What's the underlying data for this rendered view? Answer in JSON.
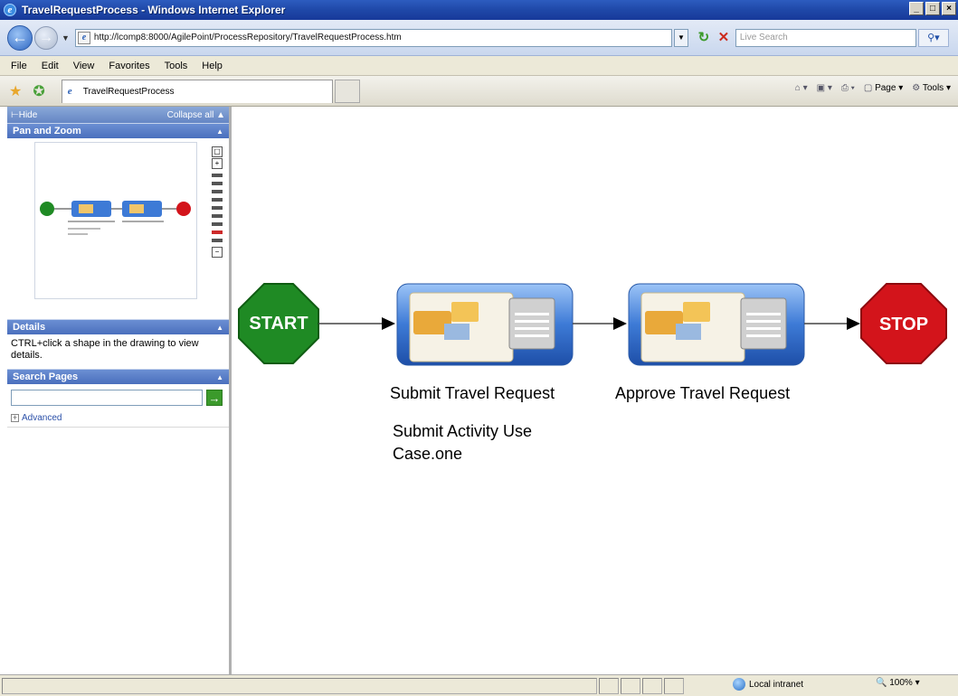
{
  "window": {
    "title": "TravelRequestProcess - Windows Internet Explorer",
    "controls": {
      "minimize": "_",
      "maximize": "□",
      "close": "×"
    }
  },
  "address_bar": {
    "url": "http://lcomp8:8000/AgilePoint/ProcessRepository/TravelRequestProcess.htm",
    "search_placeholder": "Live Search"
  },
  "menu": [
    "File",
    "Edit",
    "View",
    "Favorites",
    "Tools",
    "Help"
  ],
  "tab": {
    "label": "TravelRequestProcess"
  },
  "command_bar": {
    "page": "Page",
    "tools": "Tools"
  },
  "left_panel": {
    "hide_label": "Hide",
    "collapse_all": "Collapse all",
    "pan_zoom": {
      "header": "Pan and Zoom"
    },
    "details": {
      "header": "Details",
      "text": "CTRL+click a shape in the drawing to view details."
    },
    "search_pages": {
      "header": "Search Pages",
      "advanced_label": "Advanced"
    }
  },
  "diagram": {
    "start_label": "START",
    "stop_label": "STOP",
    "steps": [
      {
        "name": "Submit Travel Request",
        "note_line1": "Submit Activity Use",
        "note_line2": "Case.one"
      },
      {
        "name": "Approve Travel Request"
      }
    ],
    "colors": {
      "start": "#1f8a24",
      "stop": "#d3141b",
      "task": "#2e6fd0"
    }
  },
  "status_bar": {
    "zone": "Local intranet",
    "zoom": "100%"
  }
}
